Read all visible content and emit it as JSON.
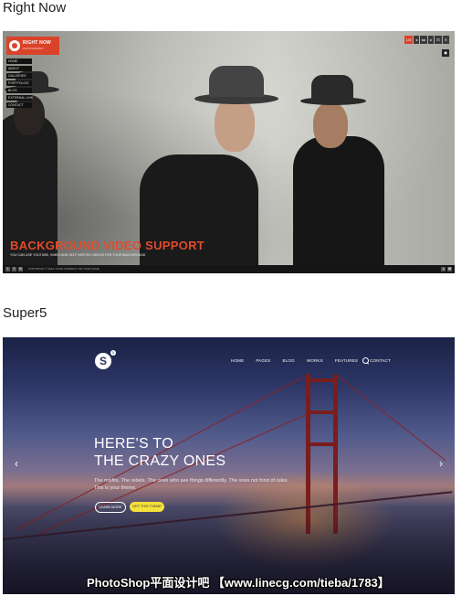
{
  "sections": [
    {
      "title": "Right Now",
      "brand_name": "RIGHT NOW",
      "brand_tagline": "PHOTOGRAPHY",
      "nav": [
        "HOME",
        "ABOUT",
        "GALLERIES",
        "PORTFOLIOS",
        "BLOG",
        "EXTERNAL LINK",
        "CONTACT"
      ],
      "slide_counter": "1/3",
      "controls": [
        "◂",
        "▸▸",
        "▸",
        "⊡",
        "✕"
      ],
      "headline": "BACKGROUND VIDEO SUPPORT",
      "subline": "YOU CAN USE YOUTUBE, VIMEO AND SELF HOSTED VIDEOS FOR YOUR BACKGROUND",
      "copyright": "COPYRIGHT © 2014 YOUR COMPANY OR YOUR NAME",
      "social": [
        "f",
        "t",
        "in"
      ],
      "footer_right": [
        "◂",
        "▤"
      ]
    },
    {
      "title": "Super5",
      "logo": "S",
      "logo_sup": "5",
      "nav": [
        "HOME",
        "PAGES",
        "BLOG",
        "WORKS",
        "FEATURES",
        "CONTACT"
      ],
      "headline_line1": "HERE'S TO",
      "headline_line2": "THE CRAZY ONES",
      "body": "The misfits. The rebels. The ones who see things differently. The ones not fond of rules. This is your theme.",
      "button_learn": "LEARN MORE",
      "button_get": "GET THIS THEME",
      "arrow_left": "‹",
      "arrow_right": "›"
    }
  ],
  "watermark": "PhotoShop平面设计吧 【www.linecg.com/tieba/1783】",
  "colors": {
    "accent_red": "#d9432a",
    "super5_yellow": "#f4e23a"
  }
}
